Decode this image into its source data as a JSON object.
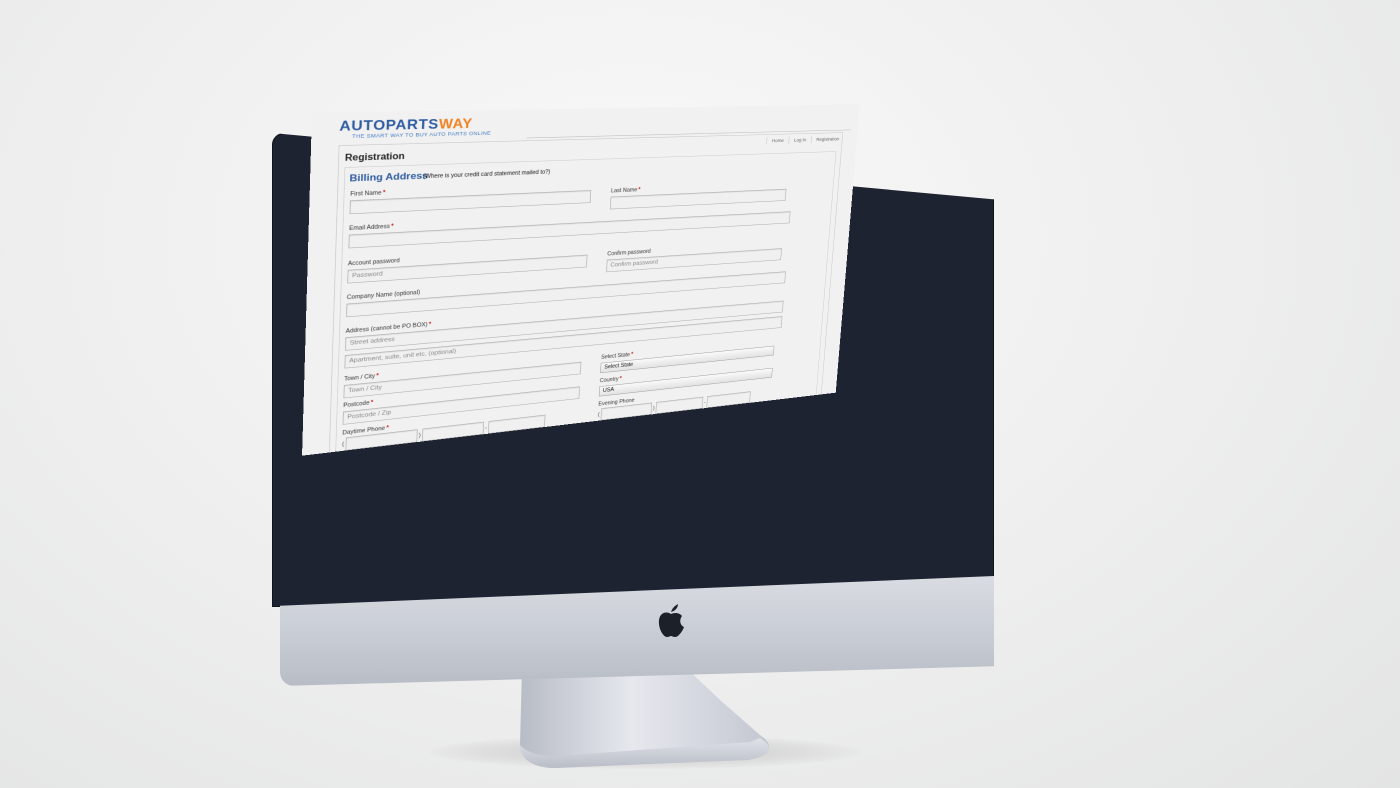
{
  "brand": {
    "logo_main": "AUTOPARTS",
    "logo_accent": "WAY",
    "tagline": "THE SMART WAY TO BUY AUTO PARTS ONLINE",
    "primary_color": "#2c5aa0",
    "accent_color": "#f0801e"
  },
  "nav": {
    "home": "Home",
    "login": "Log In",
    "registration": "Registration"
  },
  "page_title": "Registration",
  "billing": {
    "title": "Billing Address",
    "note": "(Where is your credit card statement mailed to?)"
  },
  "required_mark": "*",
  "fields": {
    "first_name": {
      "label": "First Name",
      "value": ""
    },
    "last_name": {
      "label": "Last Name",
      "value": ""
    },
    "email": {
      "label": "Email Address",
      "value": ""
    },
    "password": {
      "label": "Account password",
      "placeholder": "Password"
    },
    "confirm_password": {
      "label": "Confirm password",
      "placeholder": "Confirm password"
    },
    "company": {
      "label": "Company Name (optional)",
      "value": ""
    },
    "address": {
      "label": "Address (cannot be PO BOX)",
      "street_placeholder": "Street address",
      "apartment_placeholder": "Apartment, suite, unit etc. (optional)"
    },
    "city": {
      "label": "Town / City",
      "placeholder": "Town / City"
    },
    "state": {
      "label": "Select State",
      "selected": "Select State"
    },
    "postcode": {
      "label": "Postcode",
      "placeholder": "Postcode / Zip"
    },
    "country": {
      "label": "Country",
      "selected": "USA"
    },
    "daytime_phone": {
      "label": "Daytime Phone"
    },
    "evening_phone": {
      "label": "Evening Phone"
    }
  },
  "phone_paren": "(",
  "phone_close": ")",
  "phone_dash": "-",
  "icons": {
    "apple_logo": "apple-logo-icon"
  },
  "device_colors": {
    "bezel": "#1d2330",
    "chin": "#c9cdd4"
  }
}
